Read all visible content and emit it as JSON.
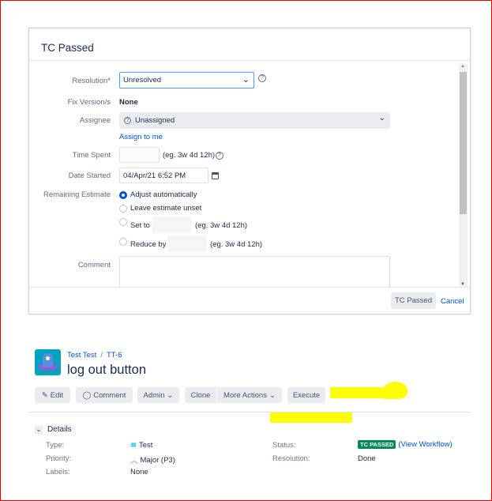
{
  "dialog": {
    "title": "TC Passed",
    "resolution": {
      "label": "Resolution",
      "required": "*",
      "value": "Unresolved"
    },
    "fix_version": {
      "label": "Fix Version/s",
      "value": "None"
    },
    "assignee": {
      "label": "Assignee",
      "value": "Unassigned",
      "assign_link": "Assign to me"
    },
    "time_spent": {
      "label": "Time Spent",
      "value": "",
      "hint": "(eg. 3w 4d 12h)"
    },
    "date_started": {
      "label": "Date Started",
      "value": "04/Apr/21 6:52 PM"
    },
    "remaining": {
      "label": "Remaining Estimate",
      "options": [
        "Adjust automatically",
        "Leave estimate unset",
        "Set to",
        "Reduce by"
      ],
      "hint": "(eg. 3w 4d 12h)",
      "selected": "Adjust automatically"
    },
    "comment": {
      "label": "Comment",
      "value": ""
    },
    "submit": "TC Passed",
    "cancel": "Cancel"
  },
  "issue": {
    "project": "Test Test",
    "key": "TT-6",
    "title": "log out button",
    "actions": {
      "edit": "Edit",
      "comment": "Comment",
      "admin": "Admin",
      "clone": "Clone",
      "more": "More Actions",
      "execute": "Execute"
    },
    "details": {
      "heading": "Details",
      "type_label": "Type:",
      "type": "Test",
      "priority_label": "Priority:",
      "priority": "Major (P3)",
      "labels_label": "Labels:",
      "labels": "None",
      "status_label": "Status:",
      "status": "TC PASSED",
      "workflow": "(View Workflow)",
      "resolution_label": "Resolution:",
      "resolution": "Done"
    }
  },
  "colors": {
    "accent": "#0052cc",
    "status": "#00875a",
    "highlight": "#ffff00",
    "frame": "#e00000"
  }
}
